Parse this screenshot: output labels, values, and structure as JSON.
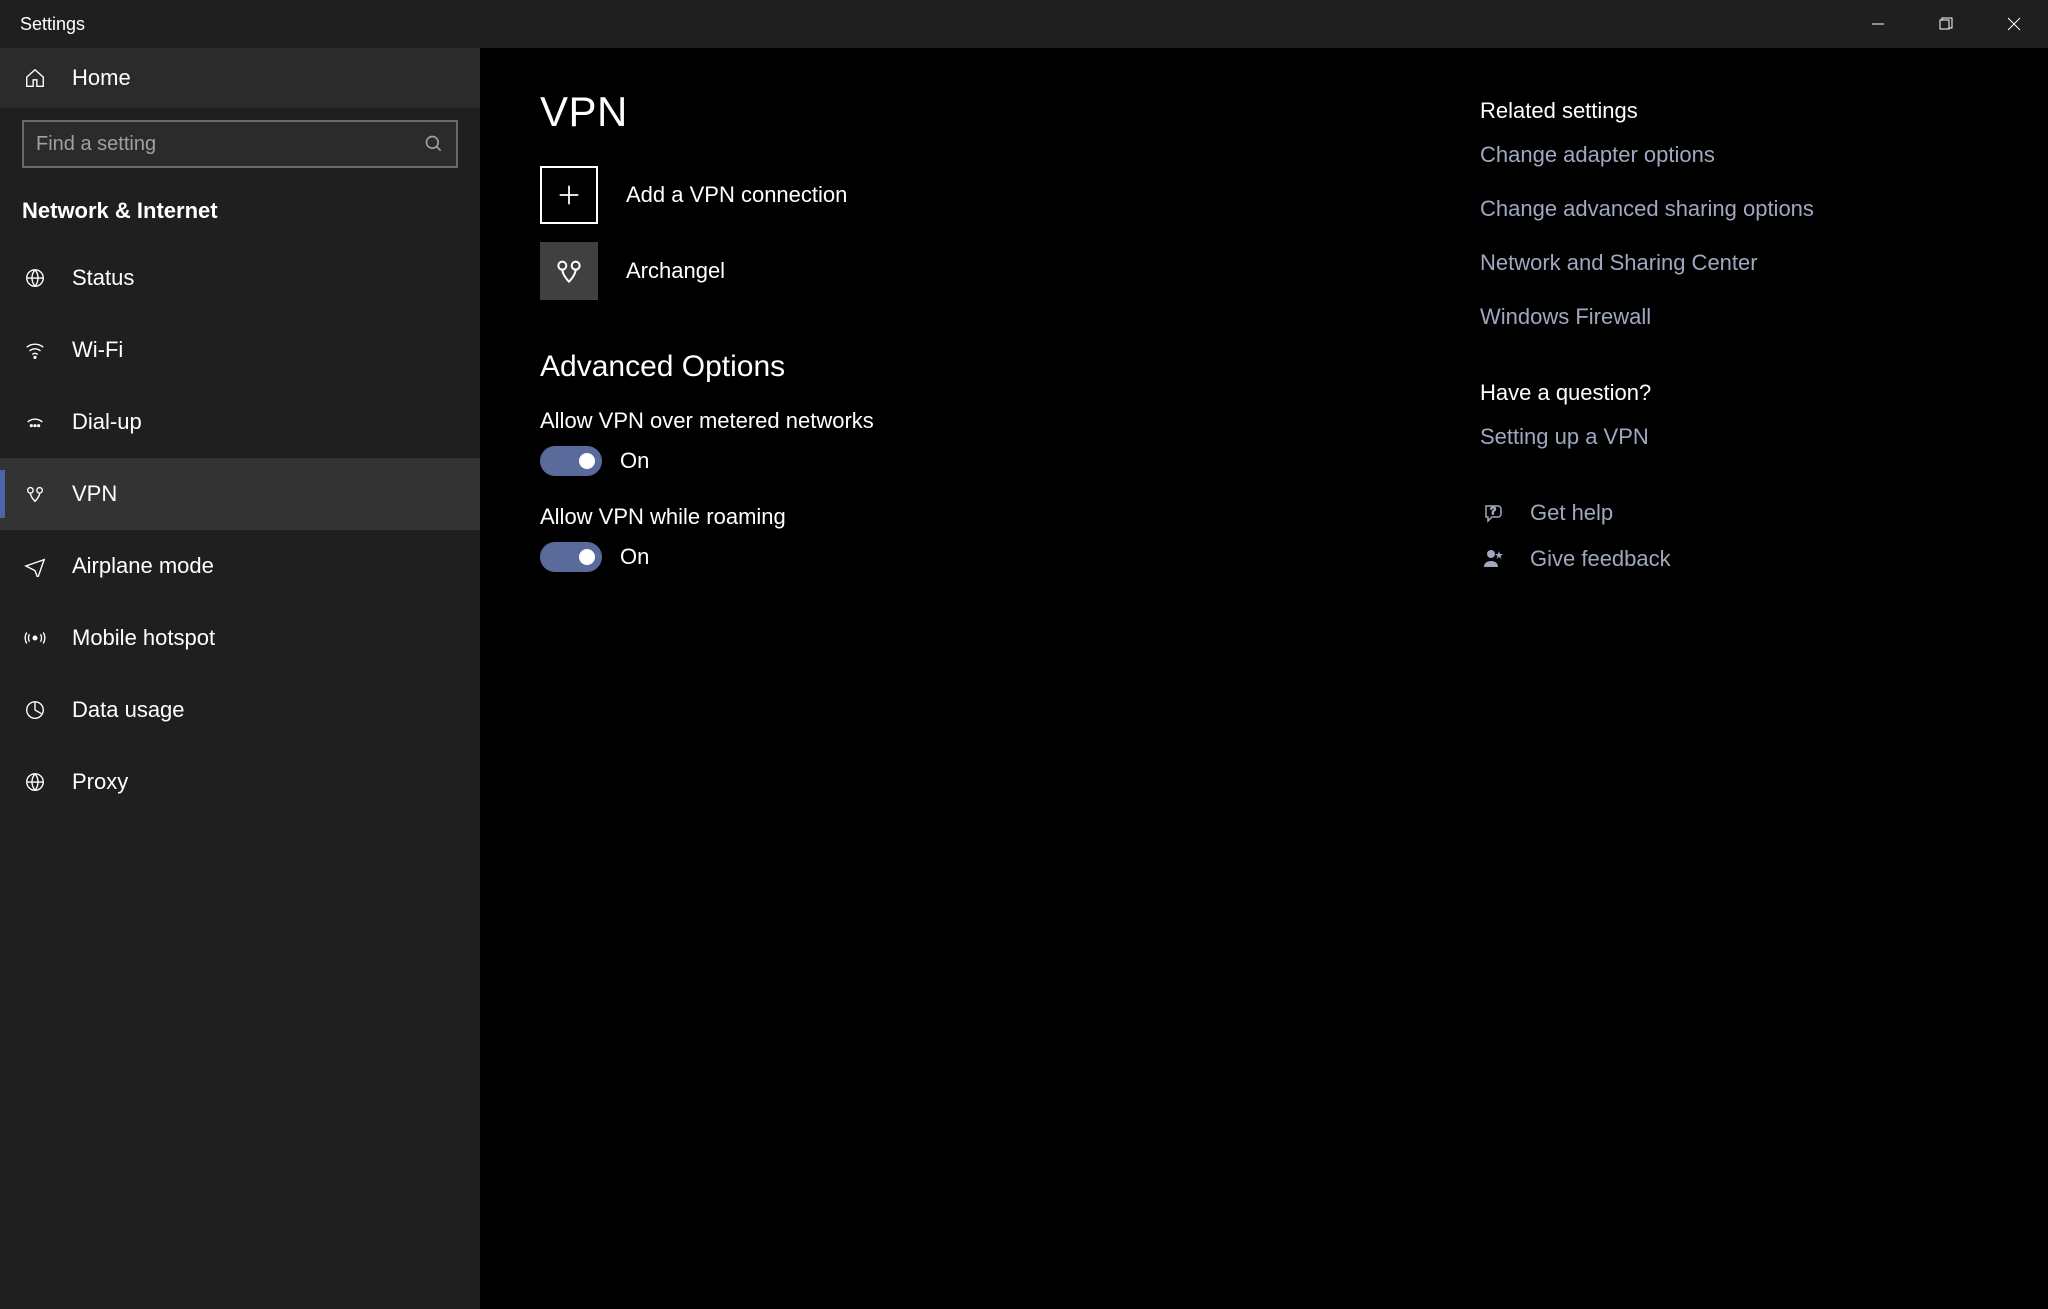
{
  "titlebar": {
    "title": "Settings"
  },
  "sidebar": {
    "home_label": "Home",
    "search_placeholder": "Find a setting",
    "category": "Network & Internet",
    "items": [
      {
        "label": "Status"
      },
      {
        "label": "Wi-Fi"
      },
      {
        "label": "Dial-up"
      },
      {
        "label": "VPN"
      },
      {
        "label": "Airplane mode"
      },
      {
        "label": "Mobile hotspot"
      },
      {
        "label": "Data usage"
      },
      {
        "label": "Proxy"
      }
    ]
  },
  "main": {
    "title": "VPN",
    "add_label": "Add a VPN connection",
    "connections": [
      {
        "name": "Archangel"
      }
    ],
    "advanced_title": "Advanced Options",
    "options": [
      {
        "label": "Allow VPN over metered networks",
        "state": "On"
      },
      {
        "label": "Allow VPN while roaming",
        "state": "On"
      }
    ]
  },
  "right": {
    "related_heading": "Related settings",
    "related_links": [
      "Change adapter options",
      "Change advanced sharing options",
      "Network and Sharing Center",
      "Windows Firewall"
    ],
    "question_heading": "Have a question?",
    "question_links": [
      "Setting up a VPN"
    ],
    "help_label": "Get help",
    "feedback_label": "Give feedback"
  }
}
